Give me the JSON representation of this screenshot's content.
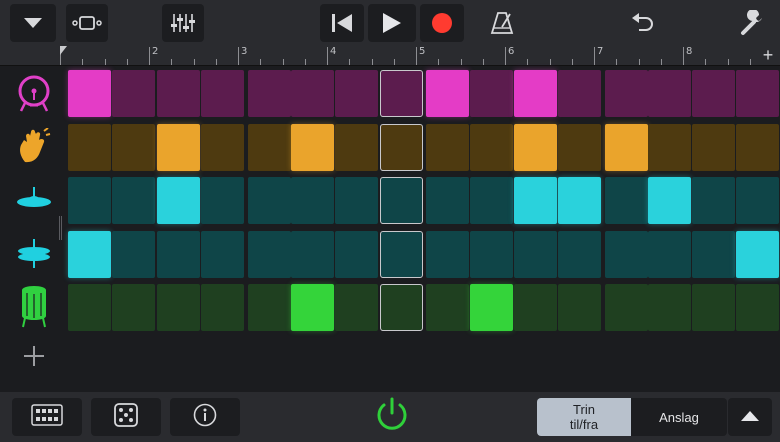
{
  "toolbar": {
    "icons": [
      "dropdown-chevron-icon",
      "tracks-view-icon",
      "mixer-sliders-icon",
      "go-to-start-icon",
      "play-icon",
      "record-icon",
      "metronome-icon",
      "undo-icon",
      "wrench-settings-icon"
    ],
    "record_color": "#ff3b30"
  },
  "ruler": {
    "bar_numbers": [
      "2",
      "3",
      "4",
      "5",
      "6",
      "7",
      "8"
    ],
    "add_label": "+"
  },
  "instruments": [
    {
      "icon": "bass-drum-icon",
      "color": "#e040c8"
    },
    {
      "icon": "clap-hand-icon",
      "color": "#f0a820"
    },
    {
      "icon": "cymbal-icon",
      "color": "#20d0e0"
    },
    {
      "icon": "hi-hat-icon",
      "color": "#20d0e0"
    },
    {
      "icon": "floor-tom-icon",
      "color": "#30d040"
    }
  ],
  "grid": {
    "selected_step": 7,
    "rows": [
      {
        "on_color": "#e43cc6",
        "off_color": "#5c1c4e",
        "steps": [
          1,
          0,
          0,
          0,
          0,
          0,
          0,
          0,
          1,
          0,
          1,
          0,
          0,
          0,
          0,
          0
        ]
      },
      {
        "on_color": "#eaa42c",
        "off_color": "#4e3a10",
        "steps": [
          0,
          0,
          1,
          0,
          0,
          1,
          0,
          0,
          0,
          0,
          1,
          0,
          1,
          0,
          0,
          0
        ]
      },
      {
        "on_color": "#2ad2dc",
        "off_color": "#0f4548",
        "steps": [
          0,
          0,
          1,
          0,
          0,
          0,
          0,
          0,
          0,
          0,
          1,
          1,
          0,
          1,
          0,
          0
        ]
      },
      {
        "on_color": "#2ad2dc",
        "off_color": "#0f4548",
        "steps": [
          1,
          0,
          0,
          0,
          0,
          0,
          0,
          0,
          0,
          0,
          0,
          0,
          0,
          0,
          0,
          1
        ]
      },
      {
        "on_color": "#34d43a",
        "off_color": "#1f4020",
        "steps": [
          0,
          0,
          0,
          0,
          0,
          1,
          0,
          0,
          0,
          1,
          0,
          0,
          0,
          0,
          0,
          0
        ]
      }
    ]
  },
  "bottombar": {
    "icons": [
      "pattern-grid-icon",
      "dice-randomize-icon",
      "info-icon",
      "power-icon",
      "collapse-up-icon"
    ],
    "power_color": "#2fd03a",
    "segment": {
      "step_toggle_label": "Trin\ntil/fra",
      "velocity_label": "Anslag"
    }
  }
}
